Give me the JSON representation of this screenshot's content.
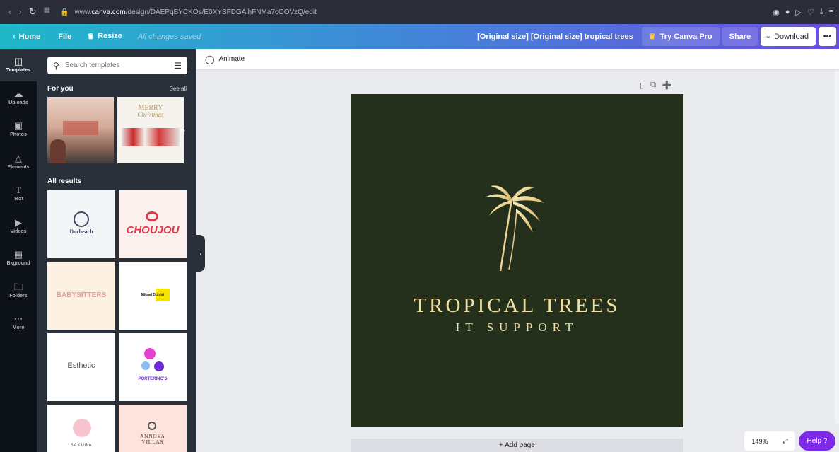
{
  "browser": {
    "url_prefix": "www.",
    "url_domain": "canva.com",
    "url_path": "/design/DAEPqBYCKOs/E0XYSFDGAihFNMa7cOOVzQ/edit"
  },
  "toolbar": {
    "home_label": "Home",
    "file_label": "File",
    "resize_label": "Resize",
    "saved_status": "All changes saved",
    "doc_title": "[Original size] [Original size] tropical trees",
    "try_pro_label": "Try Canva Pro",
    "share_label": "Share",
    "download_label": "Download"
  },
  "rail": {
    "items": [
      {
        "label": "Templates",
        "icon": "templates-icon"
      },
      {
        "label": "Uploads",
        "icon": "upload-cloud-icon"
      },
      {
        "label": "Photos",
        "icon": "photo-icon"
      },
      {
        "label": "Elements",
        "icon": "elements-icon"
      },
      {
        "label": "Text",
        "icon": "text-icon"
      },
      {
        "label": "Videos",
        "icon": "video-icon"
      },
      {
        "label": "Bkground",
        "icon": "background-icon"
      },
      {
        "label": "Folders",
        "icon": "folder-icon"
      },
      {
        "label": "More",
        "icon": "more-dots-icon"
      }
    ]
  },
  "panel": {
    "search_placeholder": "Search templates",
    "for_you_title": "For you",
    "see_all": "See all",
    "christmas_text_1": "MERRY",
    "christmas_text_2": "Christmas",
    "all_results_title": "All results",
    "templates": [
      {
        "text": "Dorbeach"
      },
      {
        "text": "CHOUJOU"
      },
      {
        "text": "BABYSITTERS"
      },
      {
        "text": "Mikael Dimitri"
      },
      {
        "text": "Esthetic"
      },
      {
        "text": "PORTERINO'S"
      },
      {
        "text": "SAKURA"
      },
      {
        "text": "ANNOVA VILLAS"
      }
    ]
  },
  "editor": {
    "animate_label": "Animate",
    "design_title": "TROPICAL TREES",
    "design_subtitle": "IT SUPPORT",
    "add_page_label": "+ Add page",
    "zoom_level": "149%",
    "help_label": "Help ?"
  },
  "colors": {
    "artboard_bg": "#24301b",
    "logo_gold": "#f0dfa0",
    "help_purple": "#7d2ae8"
  }
}
